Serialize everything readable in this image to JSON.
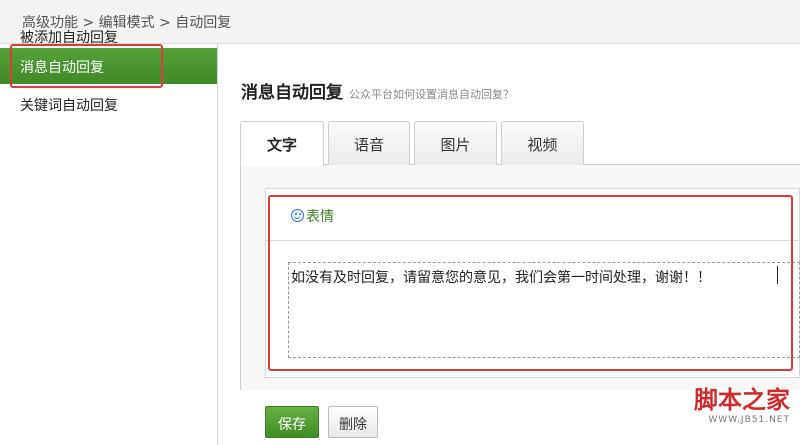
{
  "breadcrumb": "高级功能 > 编辑模式 > 自动回复",
  "sidebar": {
    "items": [
      {
        "label": "被添加自动回复"
      },
      {
        "label": "消息自动回复"
      },
      {
        "label": "关键词自动回复"
      }
    ]
  },
  "main": {
    "title": "消息自动回复",
    "subtitle": "公众平台如何设置消息自动回复？",
    "tabs": [
      {
        "label": "文字"
      },
      {
        "label": "语音"
      },
      {
        "label": "图片"
      },
      {
        "label": "视频"
      }
    ]
  },
  "editor": {
    "emoji_label": "表情",
    "text": "如没有及时回复，请留意您的意见，我们会第一时间处理，谢谢！！"
  },
  "buttons": {
    "save": "保存",
    "delete": "删除"
  },
  "watermark": {
    "main": "脚本之家",
    "url": "WWW.JB51.NET"
  },
  "colors": {
    "accent_green": "#4a9a2f",
    "highlight_red": "#e03a3a",
    "watermark_red": "#cf2d2d"
  }
}
